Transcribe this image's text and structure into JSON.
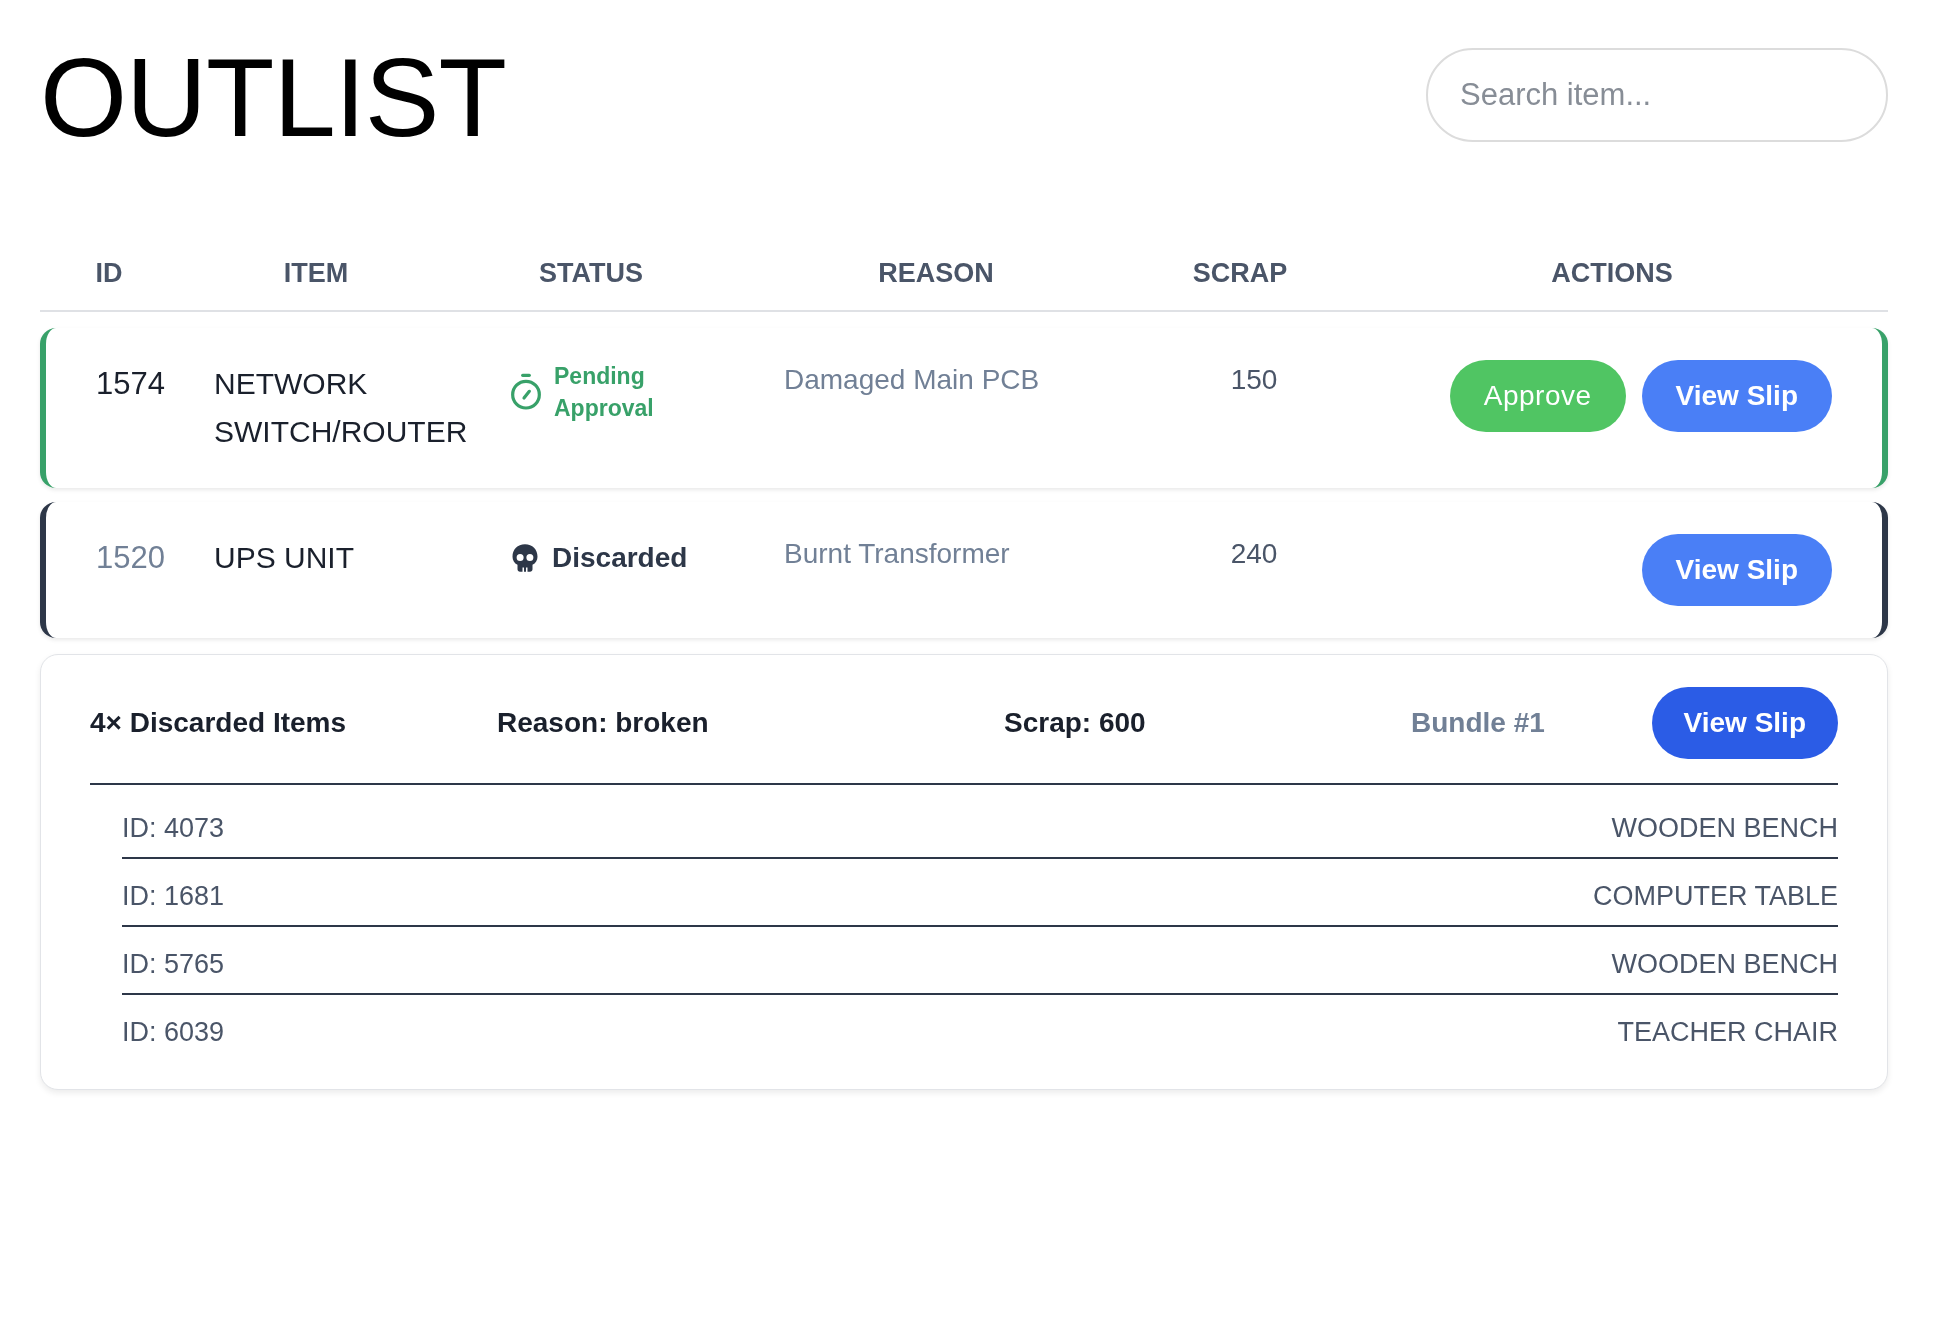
{
  "title": "OUTLIST",
  "search": {
    "placeholder": "Search item..."
  },
  "table": {
    "columns": [
      "ID",
      "ITEM",
      "STATUS",
      "REASON",
      "SCRAP",
      "ACTIONS"
    ],
    "rows": [
      {
        "id": "1574",
        "item": "NETWORK SWITCH/ROUTER",
        "status": {
          "kind": "pending",
          "label": "Pending Approval"
        },
        "reason": "Damaged Main PCB",
        "scrap": "150",
        "actions": [
          {
            "kind": "approve",
            "label": "Approve"
          },
          {
            "kind": "view",
            "label": "View Slip"
          }
        ]
      },
      {
        "id": "1520",
        "item": "UPS UNIT",
        "status": {
          "kind": "discarded",
          "label": "Discarded"
        },
        "reason": "Burnt Transformer",
        "scrap": "240",
        "actions": [
          {
            "kind": "view",
            "label": "View Slip"
          }
        ]
      }
    ]
  },
  "bundles": [
    {
      "count": "4× Discarded Items",
      "reason": "Reason: broken",
      "scrap": "Scrap: 600",
      "bundle": "Bundle #1",
      "action": "View Slip",
      "items": [
        {
          "id": "ID: 4073",
          "name": "WOODEN BENCH"
        },
        {
          "id": "ID: 1681",
          "name": "COMPUTER TABLE"
        },
        {
          "id": "ID: 5765",
          "name": "WOODEN BENCH"
        },
        {
          "id": "ID: 6039",
          "name": "TEACHER CHAIR"
        }
      ]
    }
  ]
}
